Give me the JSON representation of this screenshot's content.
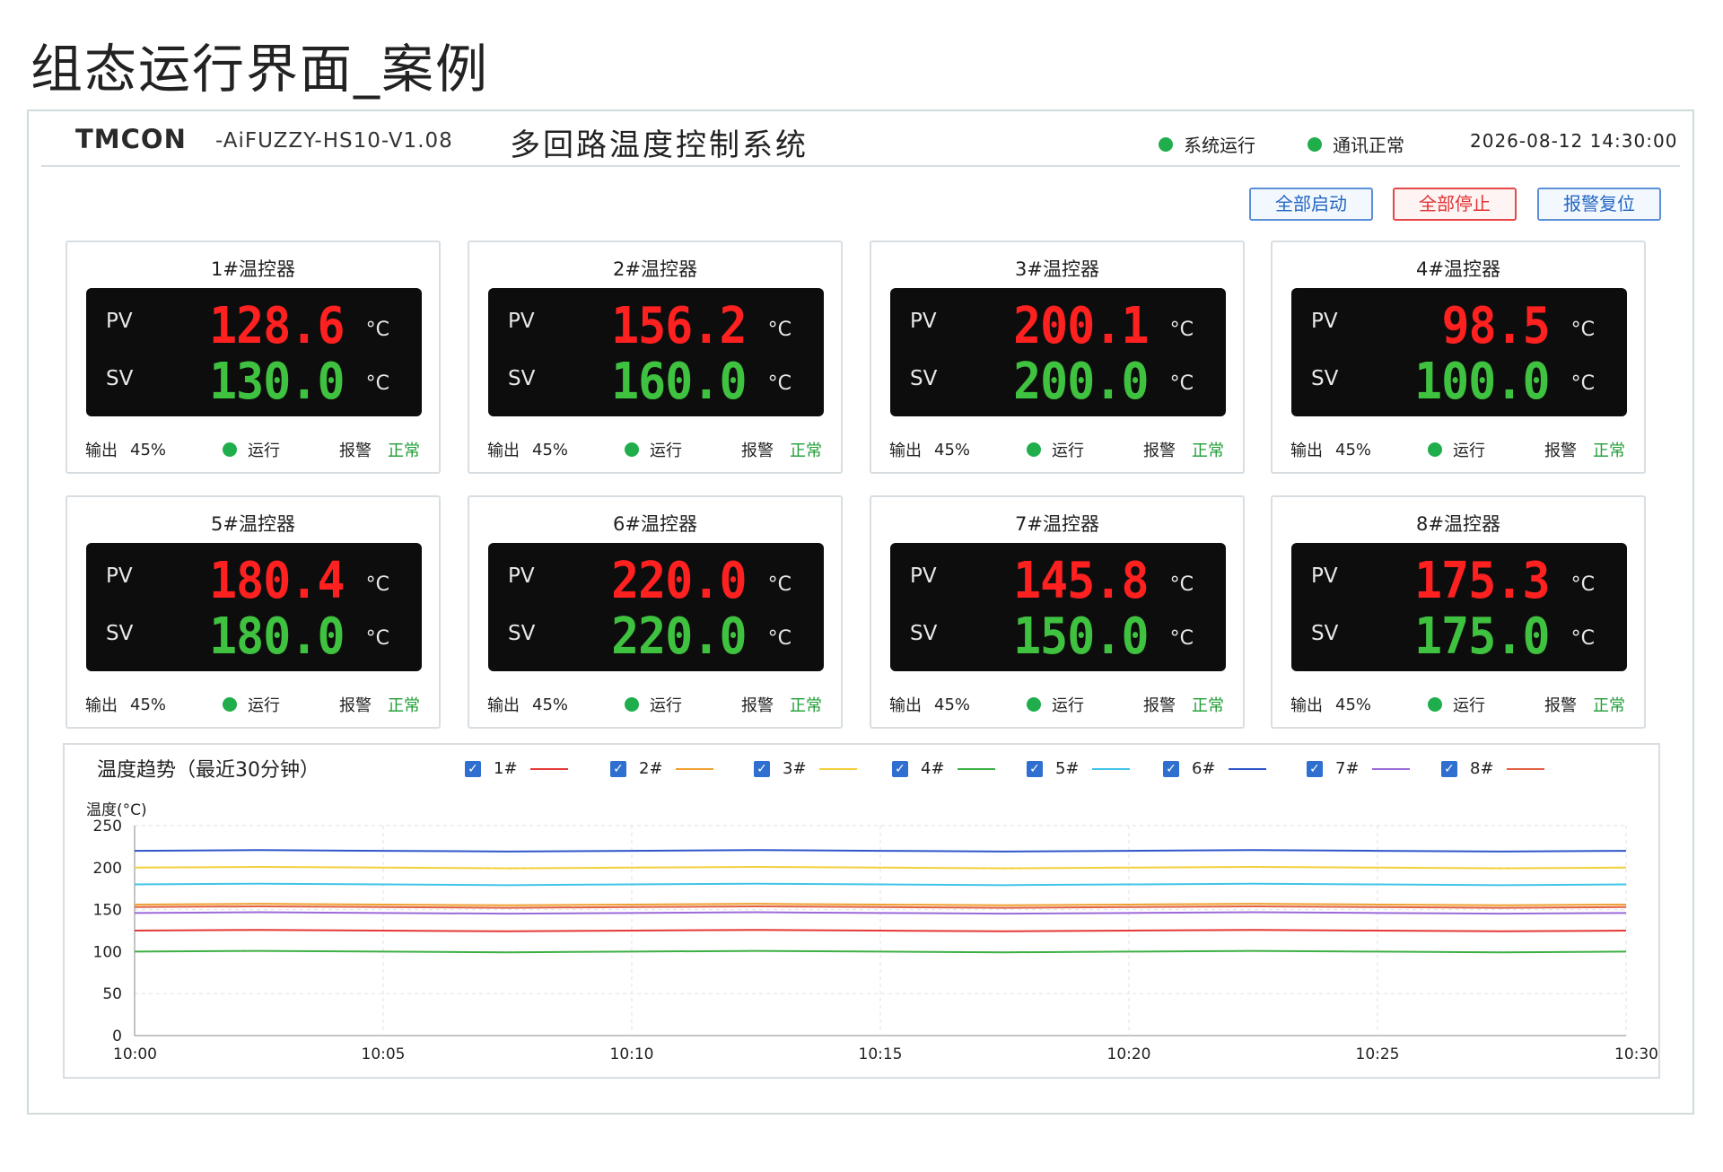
{
  "page": {
    "title": "组态运行界面_案例"
  },
  "header": {
    "brand": "TMCON",
    "model": "-AiFUZZY-HS10-V1.08",
    "system_title": "多回路温度控制系统",
    "status_run": "系统运行",
    "status_comm": "通讯正常",
    "status_color": "#1fae4b",
    "datetime": "2026-08-12  14:30:00"
  },
  "toolbar": {
    "start_all": "全部启动",
    "stop_all": "全部停止",
    "alarm_reset": "报警复位"
  },
  "common": {
    "pv_label": "PV",
    "sv_label": "SV",
    "unit": "°C",
    "output_label": "输出",
    "run_label": "运行",
    "alarm_label": "报警",
    "alarm_status": "正常"
  },
  "controllers": [
    {
      "name": "1#温控器",
      "pv": "128.6",
      "sv": "130.0",
      "output": "45%"
    },
    {
      "name": "2#温控器",
      "pv": "156.2",
      "sv": "160.0",
      "output": "45%"
    },
    {
      "name": "3#温控器",
      "pv": "200.1",
      "sv": "200.0",
      "output": "45%"
    },
    {
      "name": "4#温控器",
      "pv": "98.5",
      "sv": "100.0",
      "output": "45%"
    },
    {
      "name": "5#温控器",
      "pv": "180.4",
      "sv": "180.0",
      "output": "45%"
    },
    {
      "name": "6#温控器",
      "pv": "220.0",
      "sv": "220.0",
      "output": "45%"
    },
    {
      "name": "7#温控器",
      "pv": "145.8",
      "sv": "150.0",
      "output": "45%"
    },
    {
      "name": "8#温控器",
      "pv": "175.3",
      "sv": "175.0",
      "output": "45%"
    }
  ],
  "trend": {
    "title": "温度趋势（最近30分钟）",
    "y_unit_label": "温度(°C)"
  },
  "chart_data": {
    "type": "line",
    "title": "温度趋势（最近30分钟）",
    "ylabel": "温度(°C)",
    "xlabel": "",
    "x": [
      "10:00",
      "10:05",
      "10:10",
      "10:15",
      "10:20",
      "10:25",
      "10:30"
    ],
    "yticks": [
      0,
      50,
      100,
      150,
      200,
      250
    ],
    "ylim": [
      0,
      250
    ],
    "grid": true,
    "legend_position": "top",
    "series": [
      {
        "name": "1#",
        "color": "#e53935",
        "values": [
          125,
          125,
          125,
          125,
          125,
          125,
          125
        ]
      },
      {
        "name": "2#",
        "color": "#f0a030",
        "values": [
          156,
          156,
          156,
          156,
          156,
          156,
          156
        ]
      },
      {
        "name": "3#",
        "color": "#f2d03b",
        "values": [
          200,
          200,
          200,
          200,
          200,
          200,
          200
        ]
      },
      {
        "name": "4#",
        "color": "#3cb043",
        "values": [
          100,
          100,
          100,
          100,
          100,
          100,
          100
        ]
      },
      {
        "name": "5#",
        "color": "#40c4e8",
        "values": [
          180,
          180,
          180,
          180,
          180,
          180,
          180
        ]
      },
      {
        "name": "6#",
        "color": "#2f55c8",
        "values": [
          220,
          220,
          220,
          220,
          220,
          220,
          220
        ]
      },
      {
        "name": "7#",
        "color": "#9b6ad8",
        "values": [
          146,
          146,
          146,
          146,
          146,
          146,
          146
        ]
      },
      {
        "name": "8#",
        "color": "#e06040",
        "values": [
          153,
          153,
          153,
          153,
          153,
          153,
          153
        ]
      }
    ]
  }
}
